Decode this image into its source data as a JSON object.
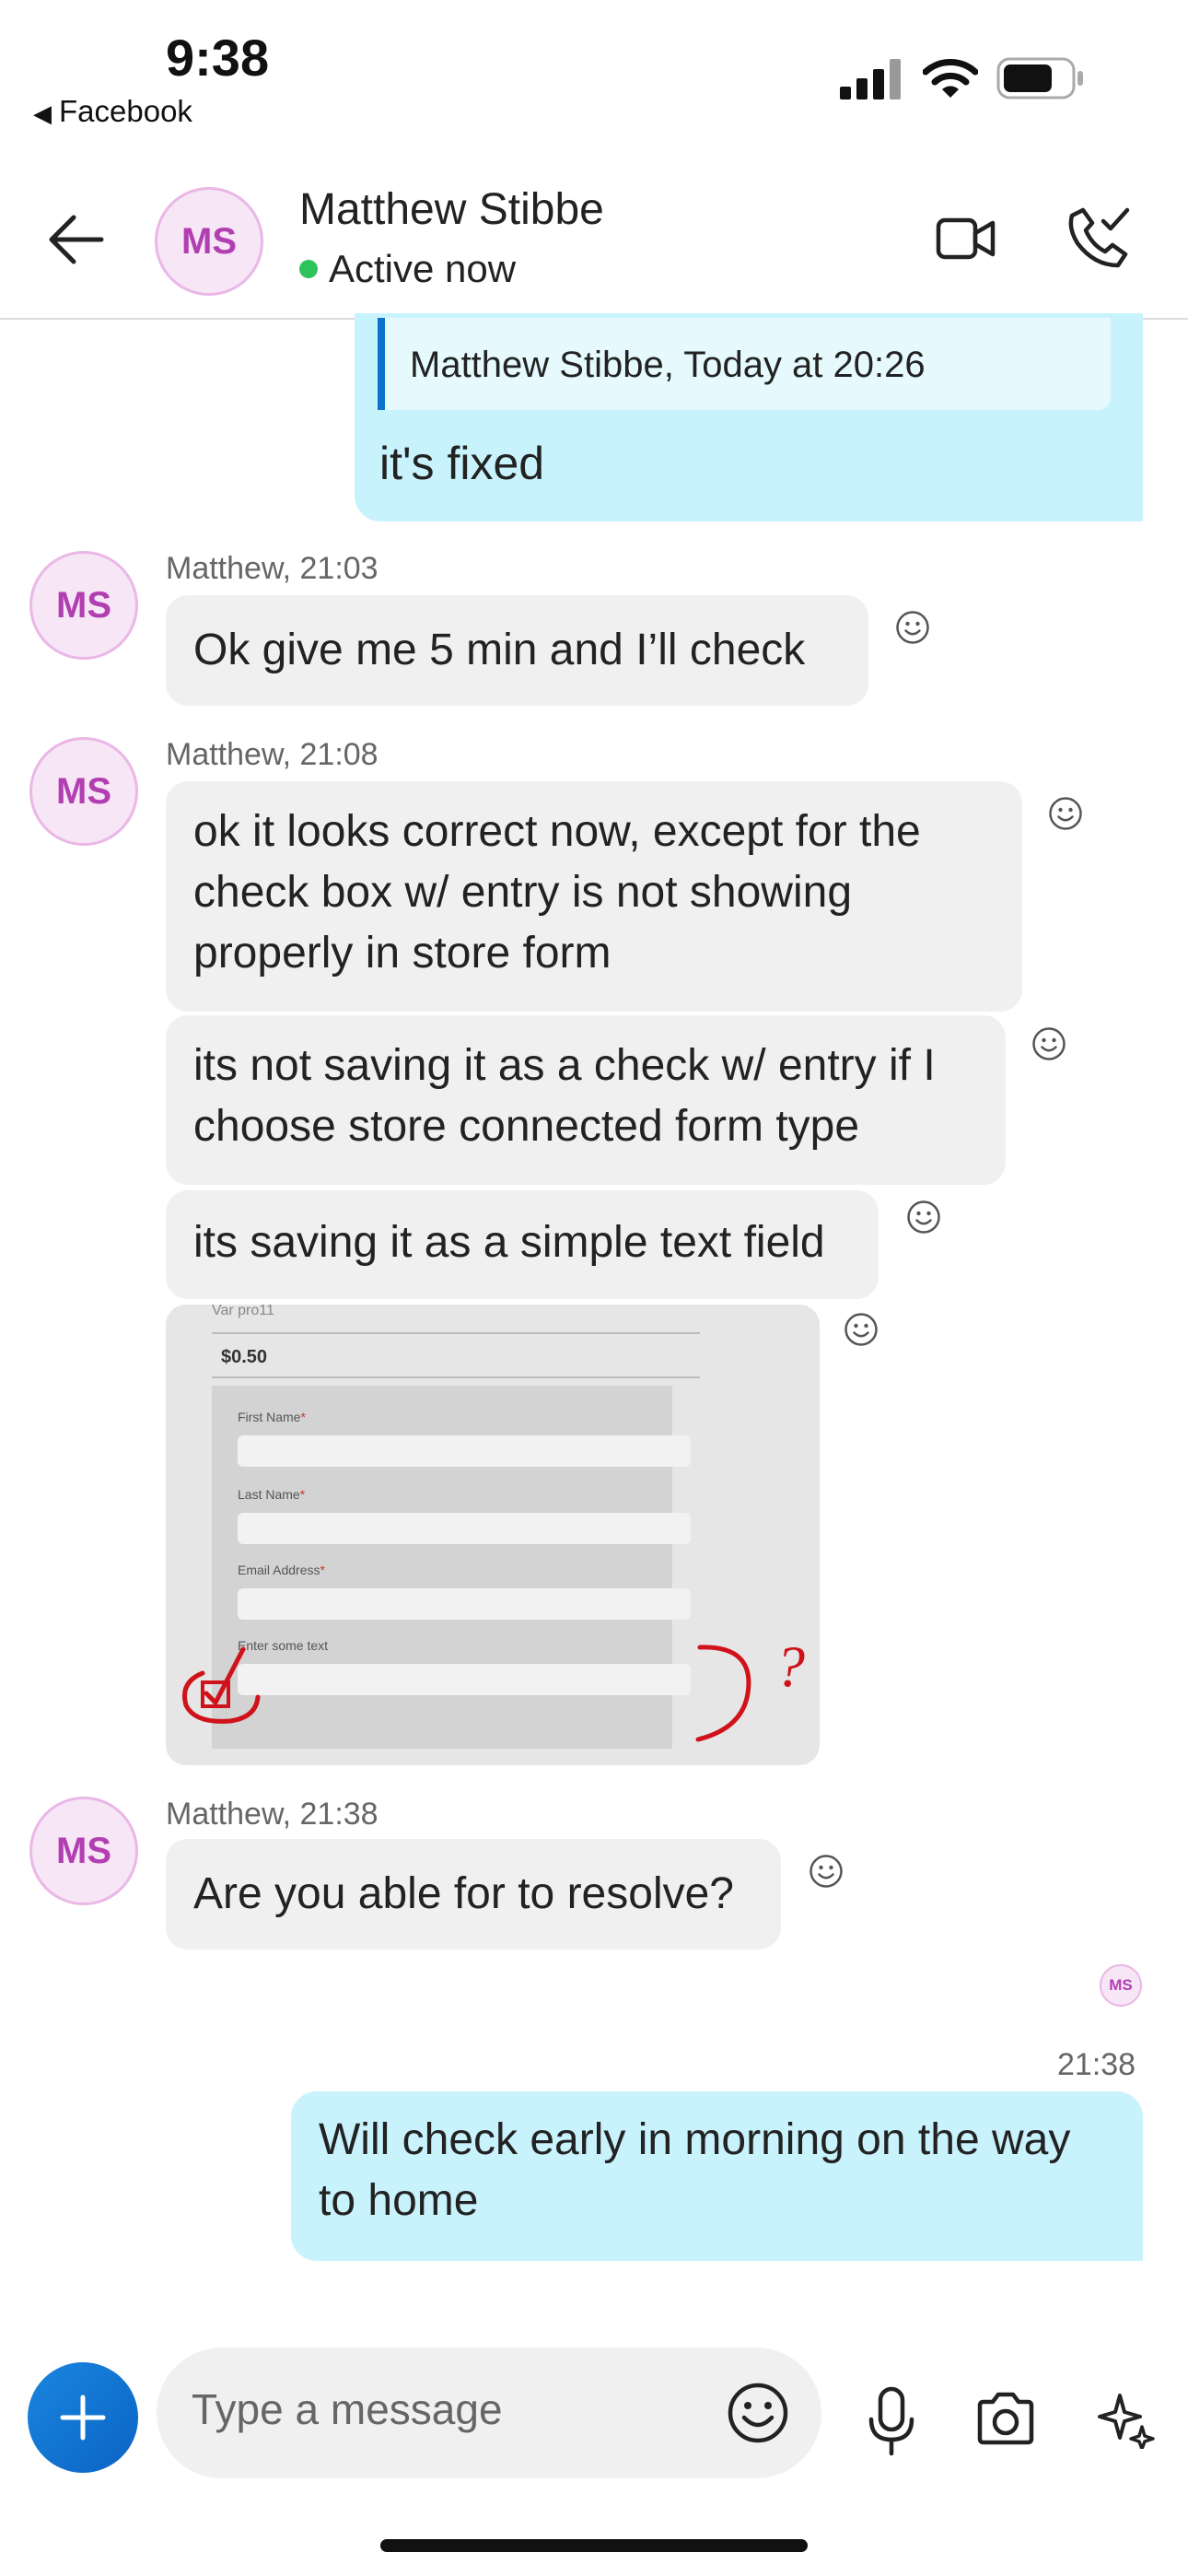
{
  "status_bar": {
    "time": "9:38",
    "back_app": "Facebook"
  },
  "header": {
    "avatar_initials": "MS",
    "contact_name": "Matthew Stibbe",
    "presence": "Active now"
  },
  "messages": {
    "quoted": {
      "quote_meta": "Matthew Stibbe, Today at 20:26",
      "text": "it's fixed"
    },
    "group1": {
      "avatar": "MS",
      "meta": "Matthew, 21:03",
      "m1": "Ok give me 5 min and I’ll check"
    },
    "group2": {
      "avatar": "MS",
      "meta": "Matthew, 21:08",
      "m1": "ok it looks correct now, except for the check box w/ entry is not showing properly in store form",
      "m2": "its not saving it as a check w/ entry if I choose store connected form type",
      "m3": "its saving it as a simple text field",
      "image": {
        "title": "Var pro11",
        "price": "$0.50",
        "field1": "First Name",
        "field2": "Last Name",
        "field3": "Email Address",
        "field4": "Enter some text",
        "asterisk": "*",
        "annotation": "?"
      }
    },
    "group3": {
      "avatar": "MS",
      "meta": "Matthew, 21:38",
      "m1": "Are you able for to resolve?"
    },
    "read_receipt": "MS",
    "outgoing": {
      "time": "21:38",
      "text": "Will check early in morning on the way to home"
    }
  },
  "composer": {
    "placeholder": "Type a message"
  },
  "colors": {
    "accent": "#0b63c3",
    "outgoing_bubble": "#c8f2fc",
    "incoming_bubble": "#f0f0f0",
    "avatar_text": "#b23fb2",
    "presence": "#2fc35c"
  }
}
